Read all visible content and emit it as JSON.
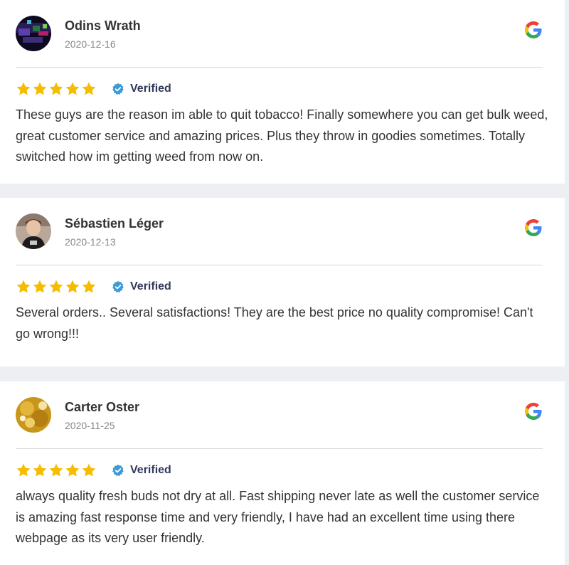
{
  "reviews": [
    {
      "name": "Odins Wrath",
      "date": "2020-12-16",
      "rating": 5,
      "verified_label": "Verified",
      "text": "These guys are the reason im able to quit tobacco! Finally somewhere you can get bulk weed, great customer service and amazing prices. Plus they throw in goodies sometimes. Totally switched how im getting weed from now on.",
      "source_icon": "google-icon"
    },
    {
      "name": "Sébastien Léger",
      "date": "2020-12-13",
      "rating": 5,
      "verified_label": "Verified",
      "text": "Several orders.. Several satisfactions! They are the best price no quality compromise! Can't go wrong!!!",
      "source_icon": "google-icon"
    },
    {
      "name": "Carter Oster",
      "date": "2020-11-25",
      "rating": 5,
      "verified_label": "Verified",
      "text": "always quality fresh buds not dry at all. Fast shipping never late as well the customer service is amazing fast response time and very friendly, I have had an excellent time using there webpage as its very user friendly.",
      "source_icon": "google-icon"
    }
  ],
  "colors": {
    "star": "#f5bc00",
    "verified_badge": "#3d9ad6",
    "verified_text": "#30395a",
    "page_background": "#eeeff2"
  }
}
